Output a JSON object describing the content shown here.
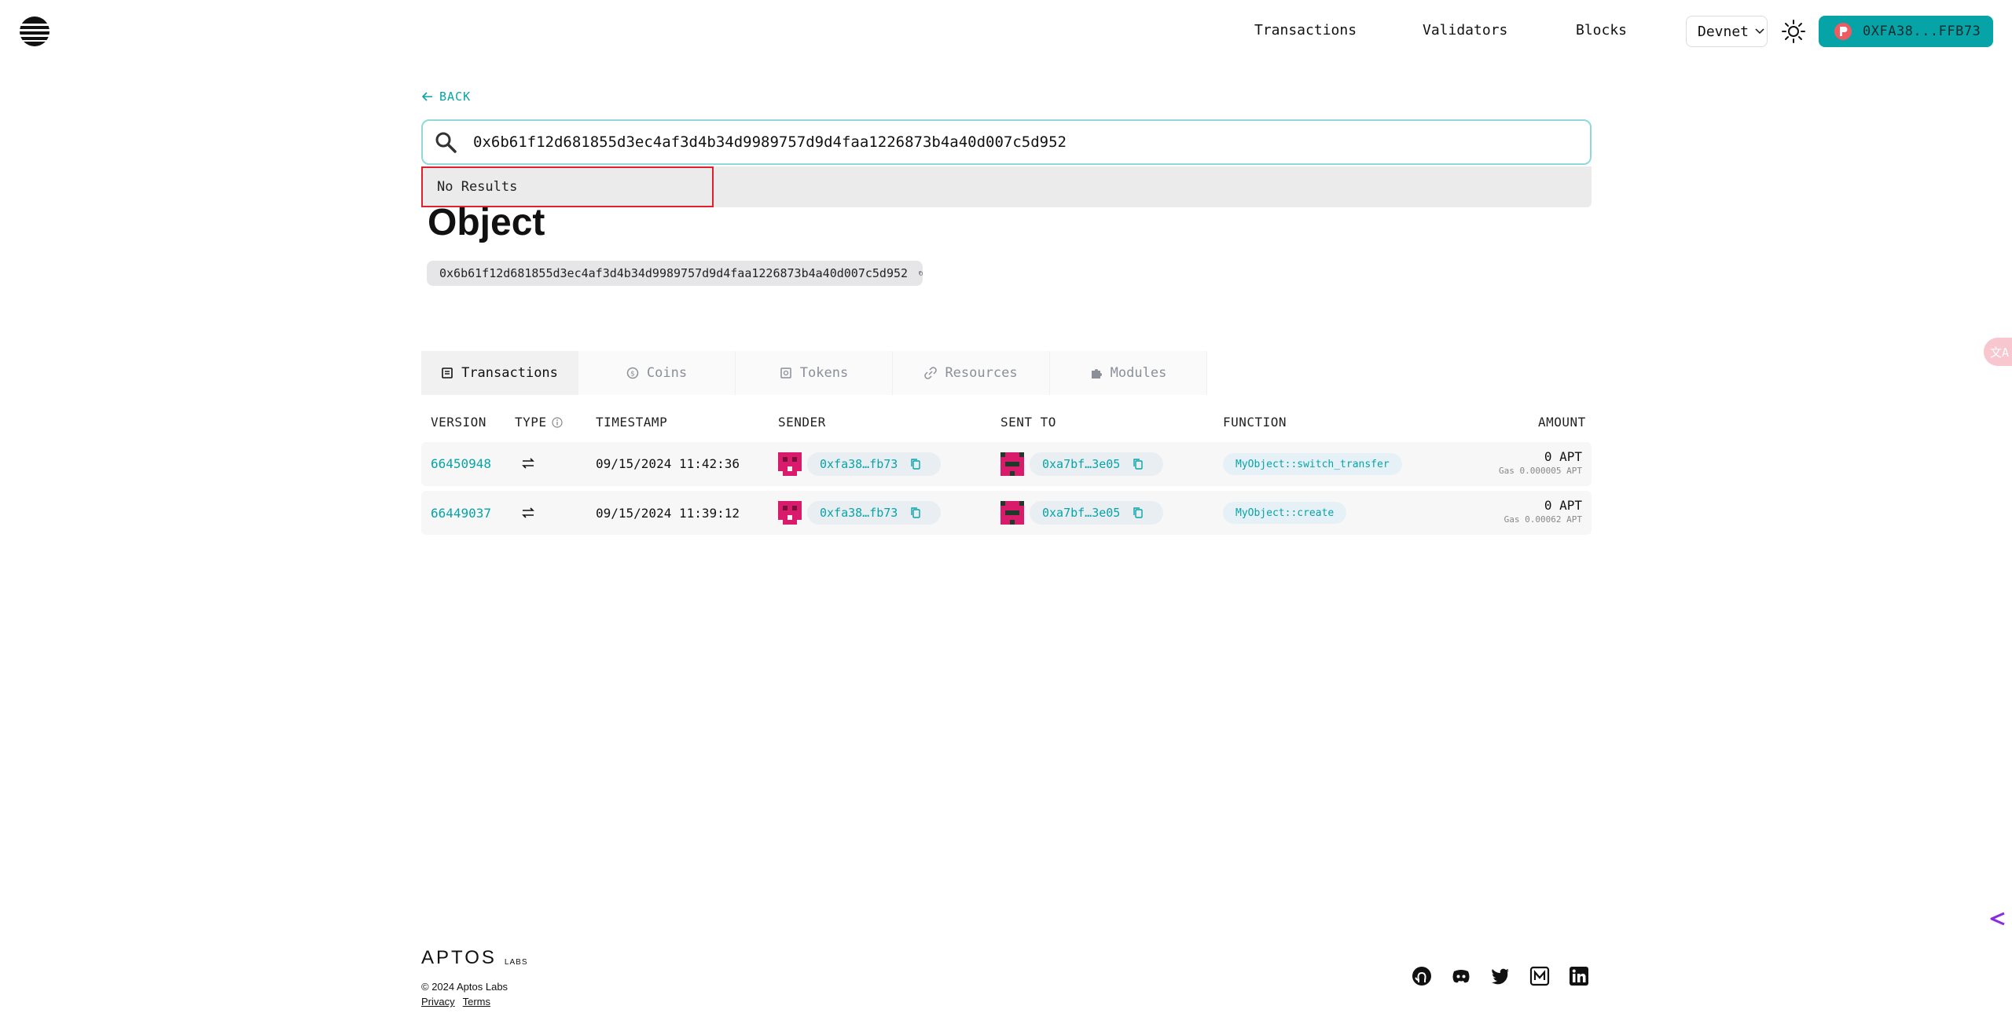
{
  "header": {
    "nav": [
      "Transactions",
      "Validators",
      "Blocks"
    ],
    "network": "Devnet",
    "wallet": "0XFA38...FFB73"
  },
  "back_label": "BACK",
  "search": {
    "value": "0x6b61f12d681855d3ec4af3d4b34d9989757d9d4faa1226873b4a40d007c5d952",
    "no_results": "No Results"
  },
  "page": {
    "title": "Object",
    "address": "0x6b61f12d681855d3ec4af3d4b34d9989757d9d4faa1226873b4a40d007c5d952"
  },
  "tabs": [
    "Transactions",
    "Coins",
    "Tokens",
    "Resources",
    "Modules"
  ],
  "table": {
    "headers": [
      "VERSION",
      "TYPE",
      "TIMESTAMP",
      "SENDER",
      "SENT TO",
      "FUNCTION",
      "AMOUNT"
    ],
    "rows": [
      {
        "version": "66450948",
        "timestamp": "09/15/2024 11:42:36",
        "sender": "0xfa38…fb73",
        "sent_to": "0xa7bf…3e05",
        "function": "MyObject::switch_transfer",
        "amount": "0 APT",
        "gas": "Gas 0.000005 APT"
      },
      {
        "version": "66449037",
        "timestamp": "09/15/2024 11:39:12",
        "sender": "0xfa38…fb73",
        "sent_to": "0xa7bf…3e05",
        "function": "MyObject::create",
        "amount": "0 APT",
        "gas": "Gas 0.00062 APT"
      }
    ]
  },
  "side": {
    "translate": "文A"
  },
  "footer": {
    "brand": "APTOS",
    "labs": "LABS",
    "copyright": "© 2024 Aptos Labs",
    "links": [
      "Privacy",
      "Terms"
    ]
  },
  "colors": {
    "accent": "#06a4a7",
    "error": "#e0202c",
    "avatar": "#d81b6a"
  },
  "icons": [
    "menu-logo-icon",
    "chevron-down-icon",
    "sun-icon",
    "petra-icon",
    "arrow-left-icon",
    "search-icon",
    "copy-icon",
    "info-icon",
    "transfer-icon",
    "github-icon",
    "discord-icon",
    "twitter-icon",
    "medium-icon",
    "linkedin-icon"
  ]
}
